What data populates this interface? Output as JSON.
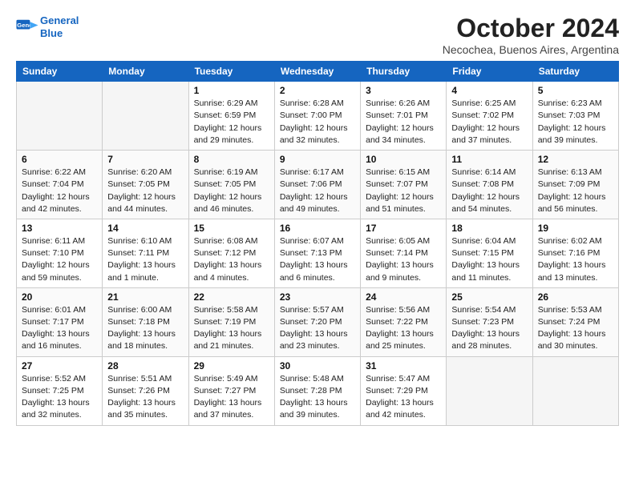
{
  "logo": {
    "line1": "General",
    "line2": "Blue"
  },
  "title": "October 2024",
  "location": "Necochea, Buenos Aires, Argentina",
  "weekdays": [
    "Sunday",
    "Monday",
    "Tuesday",
    "Wednesday",
    "Thursday",
    "Friday",
    "Saturday"
  ],
  "weeks": [
    [
      {
        "day": "",
        "empty": true
      },
      {
        "day": "",
        "empty": true
      },
      {
        "day": "1",
        "sunrise": "6:29 AM",
        "sunset": "6:59 PM",
        "daylight": "12 hours and 29 minutes."
      },
      {
        "day": "2",
        "sunrise": "6:28 AM",
        "sunset": "7:00 PM",
        "daylight": "12 hours and 32 minutes."
      },
      {
        "day": "3",
        "sunrise": "6:26 AM",
        "sunset": "7:01 PM",
        "daylight": "12 hours and 34 minutes."
      },
      {
        "day": "4",
        "sunrise": "6:25 AM",
        "sunset": "7:02 PM",
        "daylight": "12 hours and 37 minutes."
      },
      {
        "day": "5",
        "sunrise": "6:23 AM",
        "sunset": "7:03 PM",
        "daylight": "12 hours and 39 minutes."
      }
    ],
    [
      {
        "day": "6",
        "sunrise": "6:22 AM",
        "sunset": "7:04 PM",
        "daylight": "12 hours and 42 minutes."
      },
      {
        "day": "7",
        "sunrise": "6:20 AM",
        "sunset": "7:05 PM",
        "daylight": "12 hours and 44 minutes."
      },
      {
        "day": "8",
        "sunrise": "6:19 AM",
        "sunset": "7:05 PM",
        "daylight": "12 hours and 46 minutes."
      },
      {
        "day": "9",
        "sunrise": "6:17 AM",
        "sunset": "7:06 PM",
        "daylight": "12 hours and 49 minutes."
      },
      {
        "day": "10",
        "sunrise": "6:15 AM",
        "sunset": "7:07 PM",
        "daylight": "12 hours and 51 minutes."
      },
      {
        "day": "11",
        "sunrise": "6:14 AM",
        "sunset": "7:08 PM",
        "daylight": "12 hours and 54 minutes."
      },
      {
        "day": "12",
        "sunrise": "6:13 AM",
        "sunset": "7:09 PM",
        "daylight": "12 hours and 56 minutes."
      }
    ],
    [
      {
        "day": "13",
        "sunrise": "6:11 AM",
        "sunset": "7:10 PM",
        "daylight": "12 hours and 59 minutes."
      },
      {
        "day": "14",
        "sunrise": "6:10 AM",
        "sunset": "7:11 PM",
        "daylight": "13 hours and 1 minute."
      },
      {
        "day": "15",
        "sunrise": "6:08 AM",
        "sunset": "7:12 PM",
        "daylight": "13 hours and 4 minutes."
      },
      {
        "day": "16",
        "sunrise": "6:07 AM",
        "sunset": "7:13 PM",
        "daylight": "13 hours and 6 minutes."
      },
      {
        "day": "17",
        "sunrise": "6:05 AM",
        "sunset": "7:14 PM",
        "daylight": "13 hours and 9 minutes."
      },
      {
        "day": "18",
        "sunrise": "6:04 AM",
        "sunset": "7:15 PM",
        "daylight": "13 hours and 11 minutes."
      },
      {
        "day": "19",
        "sunrise": "6:02 AM",
        "sunset": "7:16 PM",
        "daylight": "13 hours and 13 minutes."
      }
    ],
    [
      {
        "day": "20",
        "sunrise": "6:01 AM",
        "sunset": "7:17 PM",
        "daylight": "13 hours and 16 minutes."
      },
      {
        "day": "21",
        "sunrise": "6:00 AM",
        "sunset": "7:18 PM",
        "daylight": "13 hours and 18 minutes."
      },
      {
        "day": "22",
        "sunrise": "5:58 AM",
        "sunset": "7:19 PM",
        "daylight": "13 hours and 21 minutes."
      },
      {
        "day": "23",
        "sunrise": "5:57 AM",
        "sunset": "7:20 PM",
        "daylight": "13 hours and 23 minutes."
      },
      {
        "day": "24",
        "sunrise": "5:56 AM",
        "sunset": "7:22 PM",
        "daylight": "13 hours and 25 minutes."
      },
      {
        "day": "25",
        "sunrise": "5:54 AM",
        "sunset": "7:23 PM",
        "daylight": "13 hours and 28 minutes."
      },
      {
        "day": "26",
        "sunrise": "5:53 AM",
        "sunset": "7:24 PM",
        "daylight": "13 hours and 30 minutes."
      }
    ],
    [
      {
        "day": "27",
        "sunrise": "5:52 AM",
        "sunset": "7:25 PM",
        "daylight": "13 hours and 32 minutes."
      },
      {
        "day": "28",
        "sunrise": "5:51 AM",
        "sunset": "7:26 PM",
        "daylight": "13 hours and 35 minutes."
      },
      {
        "day": "29",
        "sunrise": "5:49 AM",
        "sunset": "7:27 PM",
        "daylight": "13 hours and 37 minutes."
      },
      {
        "day": "30",
        "sunrise": "5:48 AM",
        "sunset": "7:28 PM",
        "daylight": "13 hours and 39 minutes."
      },
      {
        "day": "31",
        "sunrise": "5:47 AM",
        "sunset": "7:29 PM",
        "daylight": "13 hours and 42 minutes."
      },
      {
        "day": "",
        "empty": true
      },
      {
        "day": "",
        "empty": true
      }
    ]
  ]
}
